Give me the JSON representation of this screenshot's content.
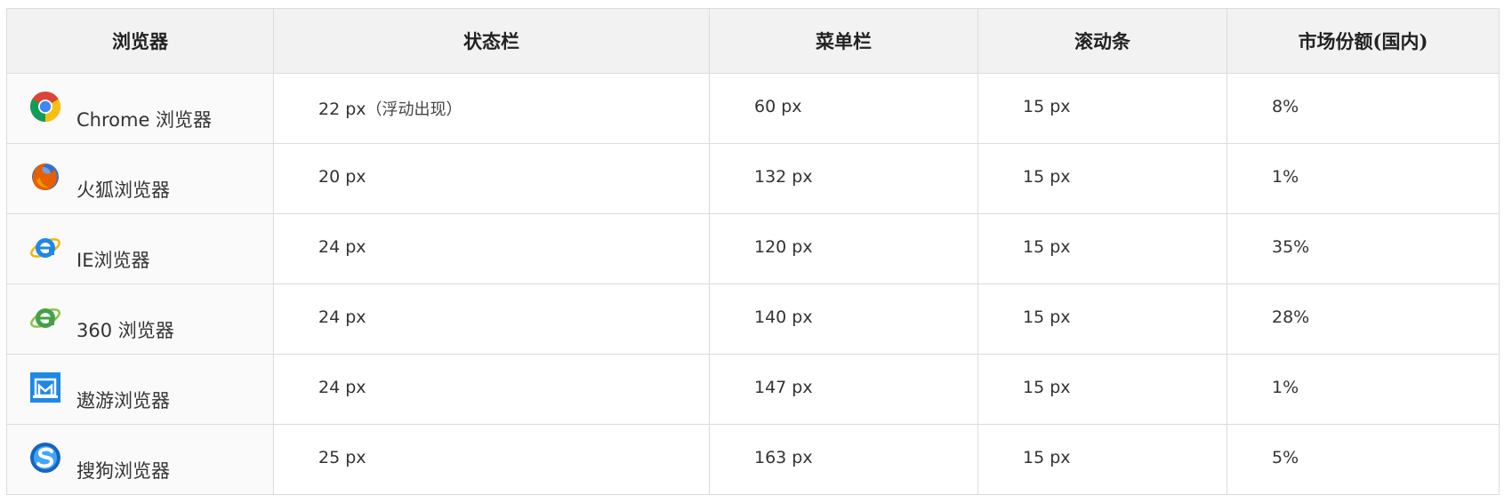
{
  "table": {
    "headers": {
      "browser": "浏览器",
      "status_bar": "状态栏",
      "menu_bar": "菜单栏",
      "scrollbar": "滚动条",
      "market_share": "市场份额(国内)"
    },
    "rows": [
      {
        "icon": "chrome-icon",
        "browser": "Chrome 浏览器",
        "status_bar": "22 px",
        "status_note": "（浮动出现）",
        "menu_bar": "60 px",
        "scrollbar": "15 px",
        "market_share": "8%"
      },
      {
        "icon": "firefox-icon",
        "browser": "火狐浏览器",
        "status_bar": "20 px",
        "status_note": "",
        "menu_bar": "132 px",
        "scrollbar": "15 px",
        "market_share": "1%"
      },
      {
        "icon": "ie-icon",
        "browser": "IE浏览器",
        "status_bar": "24 px",
        "status_note": "",
        "menu_bar": "120 px",
        "scrollbar": "15 px",
        "market_share": "35%"
      },
      {
        "icon": "360-browser-icon",
        "browser": "360 浏览器",
        "status_bar": "24 px",
        "status_note": "",
        "menu_bar": "140 px",
        "scrollbar": "15 px",
        "market_share": "28%"
      },
      {
        "icon": "maxthon-icon",
        "browser": "遨游浏览器",
        "status_bar": "24 px",
        "status_note": "",
        "menu_bar": "147 px",
        "scrollbar": "15 px",
        "market_share": "1%"
      },
      {
        "icon": "sogou-icon",
        "browser": "搜狗浏览器",
        "status_bar": "25 px",
        "status_note": "",
        "menu_bar": "163 px",
        "scrollbar": "15 px",
        "market_share": "5%"
      }
    ]
  },
  "colors": {
    "header_bg": "#f2f2f2",
    "border": "#dcdcdc",
    "text": "#333333"
  }
}
